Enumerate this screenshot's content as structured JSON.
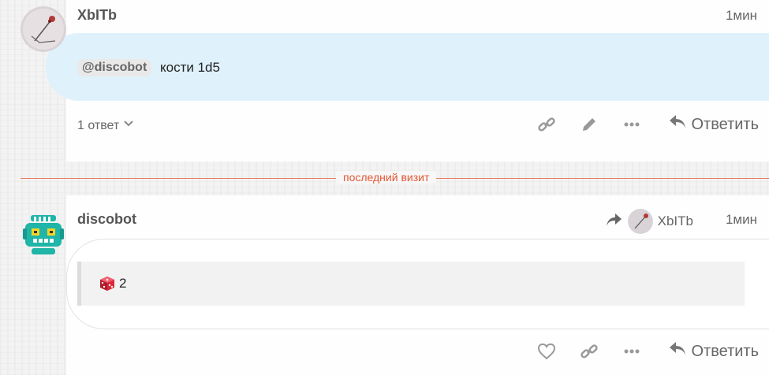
{
  "posts": [
    {
      "username": "XbITb",
      "time": "1мин",
      "mention": "@discobot",
      "message": "кости 1d5",
      "replies_label": "1 ответ",
      "reply_label": "Ответить"
    },
    {
      "username": "discobot",
      "time": "1мин",
      "reply_to_user": "XbITb",
      "dice_result": "2",
      "reply_label": "Ответить"
    }
  ],
  "divider_label": "последний визит",
  "colors": {
    "mention_bg": "#e9e9e9",
    "highlight_bubble": "#dff1fb",
    "divider": "#e45735",
    "bot_avatar": "#1fb5a8"
  }
}
